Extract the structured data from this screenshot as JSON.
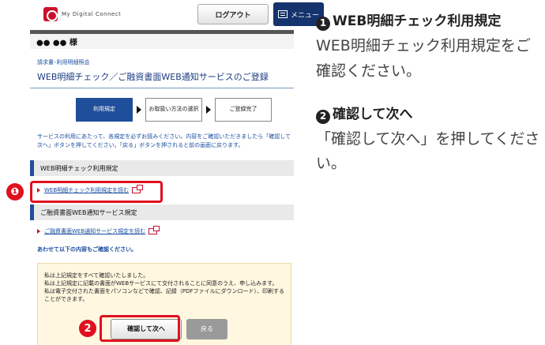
{
  "header": {
    "brand": "My Digital Connect",
    "logout_label": "ログアウト",
    "menu_label": "メニュー"
  },
  "user": {
    "name_label": "●● ●● 様"
  },
  "breadcrumb": "請求書･利用明細照会",
  "page_title": "WEB明細チェック／ご融資書面WEB通知サービスのご登録",
  "steps": [
    {
      "label": "利用規定",
      "active": true
    },
    {
      "label": "お取扱い方法の選択",
      "active": false
    },
    {
      "label": "ご登録完了",
      "active": false
    }
  ],
  "notice": "サービスの利用にあたって、各規定を必ずお読みください。内容をご確認いただきましたら「確認して次へ」ボタンを押してください。「戻る」ボタンを押されると前の画面に戻ります。",
  "sections": [
    {
      "title": "WEB明細チェック利用規定",
      "link": "WEB明細チェック利用規定を読む"
    },
    {
      "title": "ご融資書面WEB通知サービス規定",
      "link": "ご融資書面WEB通知サービス規定を読む"
    }
  ],
  "also_confirm": "あわせて以下の内容もご確認ください。",
  "confirm_text": [
    "私は上記規定をすべて確認いたしました。",
    "私は上記規定に記載の書面がWEBサービスにて交付されることに同意のうえ、申し込みます。",
    "私は電子交付された書面をパソコンなどで確認、記録（PDFファイルにダウンロード）、印刷することができます。"
  ],
  "buttons": {
    "confirm": "確認して次へ",
    "back": "戻る"
  },
  "callouts": {
    "one": "❶",
    "two": "2"
  },
  "instructions": [
    {
      "num": "1",
      "title": "WEB明細チェック利用規定",
      "body": "WEB明細チェック利用規定をご確認ください。"
    },
    {
      "num": "2",
      "title": "確認して次へ",
      "body": "「確認して次へ」を押してください。"
    }
  ],
  "colors": {
    "accent": "#1f4e9a",
    "highlight": "#e0101f",
    "menu": "#15336d"
  }
}
